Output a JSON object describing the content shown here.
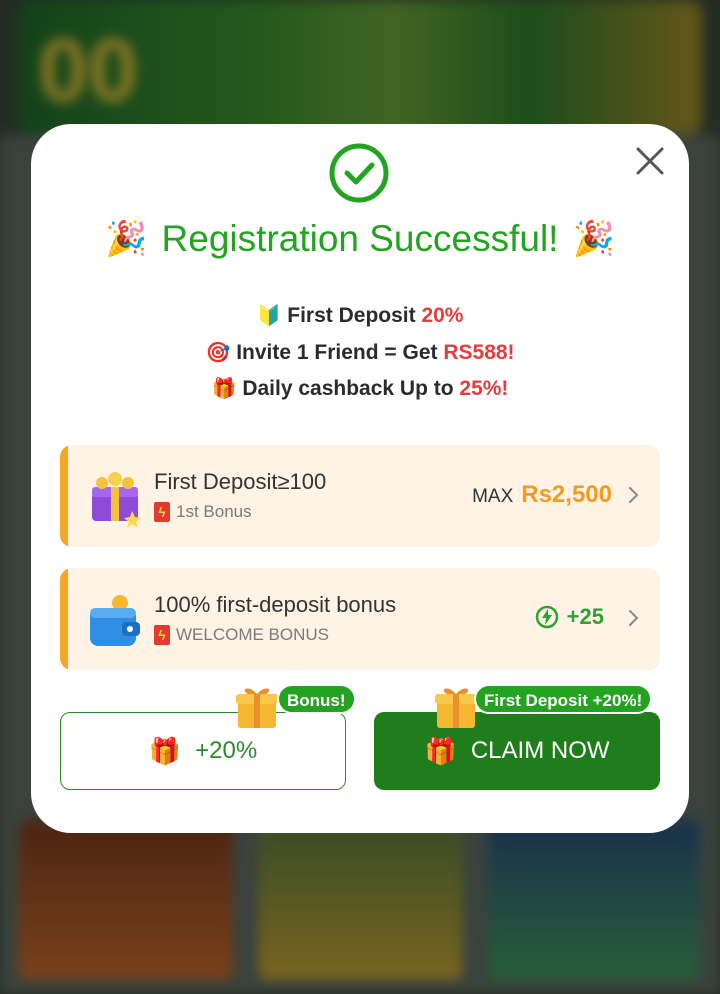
{
  "modal": {
    "title": "Registration Successful!",
    "promos": [
      {
        "emoji": "🔰",
        "text": "First Deposit ",
        "highlight": "20%"
      },
      {
        "emoji": "🎯",
        "text": "Invite 1 Friend = Get ",
        "highlight": "RS588!"
      },
      {
        "emoji": "🎁",
        "text": "Daily cashback Up to ",
        "highlight": "25%!"
      }
    ],
    "cards": [
      {
        "title": "First Deposit≥100",
        "subtitle": "1st Bonus",
        "max_label": "MAX",
        "amount": "Rs2,500"
      },
      {
        "title": "100% first-deposit bonus",
        "subtitle": "WELCOME BONUS",
        "reward": "+25"
      }
    ],
    "left_button": {
      "label": "+20%",
      "tag": "Bonus!"
    },
    "right_button": {
      "label": "CLAIM NOW",
      "tag": "First Deposit +20%!"
    }
  },
  "background": {
    "banner_number": "00"
  },
  "colors": {
    "accent_green": "#23a31f",
    "button_green": "#1f7d1c",
    "highlight_red": "#e63c3c",
    "amount_orange": "#f59b1f",
    "card_bg": "#fef3e4",
    "card_stripe": "#f5a623"
  },
  "icons": {
    "check": "check-circle-icon",
    "close": "close-icon",
    "party": "party-popper-icon",
    "gift": "gift-icon",
    "bolt": "bolt-icon",
    "chevron": "chevron-right-icon"
  }
}
